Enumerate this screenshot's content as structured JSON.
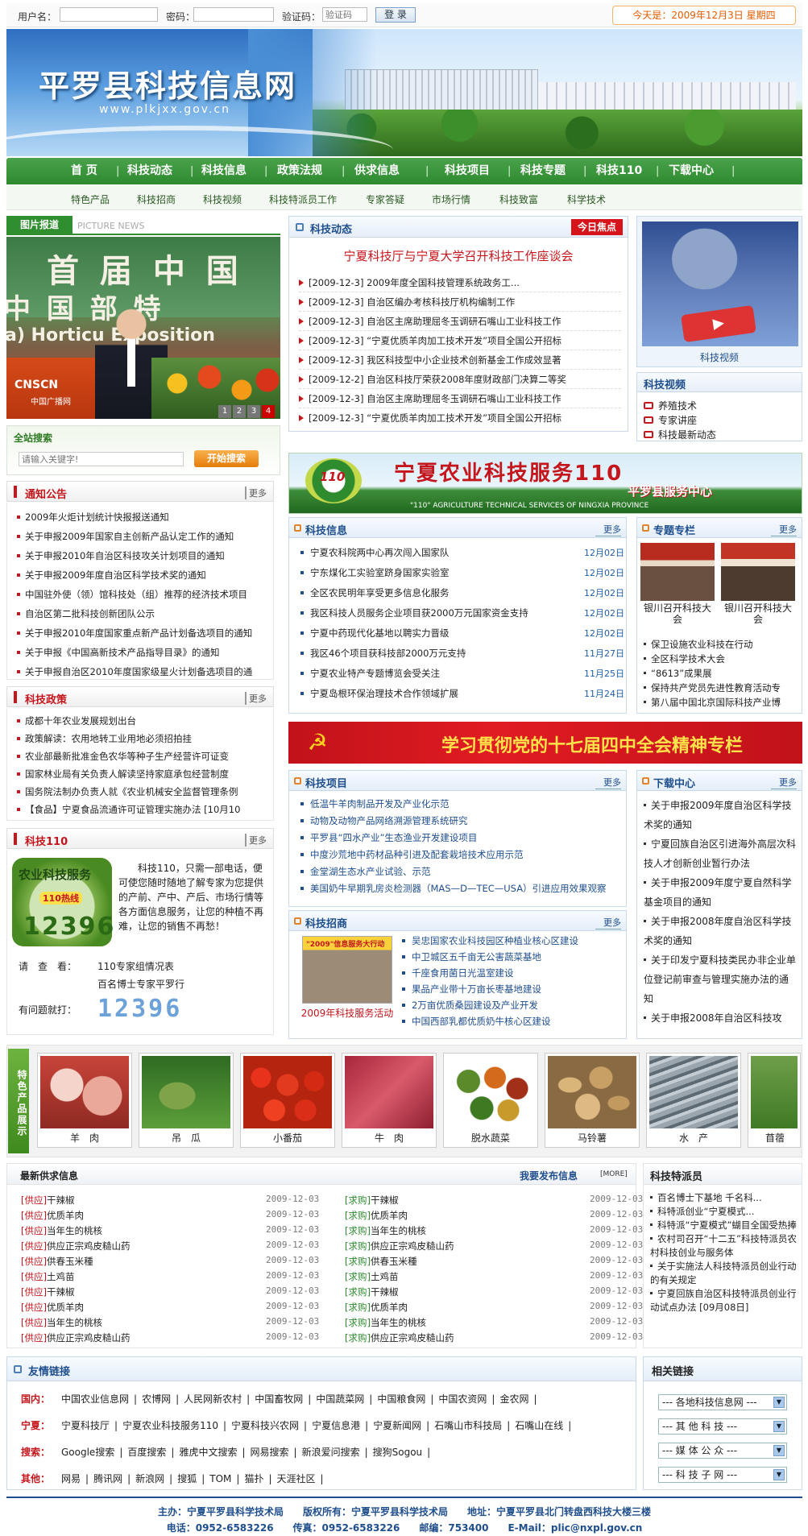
{
  "login": {
    "user_label": "用户名：",
    "pass_label": "密码：",
    "code_label": "验证码：",
    "code_placeholder": "验证码",
    "login_btn": "登 录",
    "date_text": "今天是：2009年12月3日  星期四"
  },
  "banner": {
    "title": "平罗县科技信息网",
    "url": "www.plkjxx.gov.cn"
  },
  "nav": [
    "首  页",
    "科技动态",
    "科技信息",
    "政策法规",
    "供求信息",
    "科技项目",
    "科技专题",
    "科技110",
    "下载中心"
  ],
  "subnav": [
    "特色产品",
    "科技招商",
    "科技视频",
    "科技特派员工作",
    "专家答疑",
    "市场行情",
    "科技致富",
    "科学技术"
  ],
  "photo": {
    "tab": "图片报道",
    "tab_en": "PICTURE NEWS",
    "caption_big": "首 届 中 国",
    "caption_2": "中 国  部 特",
    "caption_3": "a) Horticu   Exposition",
    "logo": "CNSCN",
    "logo_sub": "中国广播网",
    "pages": [
      "1",
      "2",
      "3",
      "4"
    ]
  },
  "search": {
    "title": "全站搜索",
    "placeholder": "请输入关键字!",
    "btn": "开始搜索"
  },
  "notice": {
    "title": "通知公告",
    "more": "更多",
    "items": [
      "2009年火炬计划统计快报报送通知",
      "关于申报2009年国家自主创新产品认定工作的通知",
      "关于申报2010年自治区科技攻关计划项目的通知",
      "关于申报2009年度自治区科学技术奖的通知",
      "中国驻外使（领）馆科技处（组）推荐的经济技术项目",
      "自治区第二批科技创新团队公示",
      "关于申报2010年度国家重点新产品计划备选项目的通知",
      "关于申报《中国高新技术产品指导目录》的通知",
      "关于申报自治区2010年度国家级星火计划备选项目的通"
    ]
  },
  "policy": {
    "title": "科技政策",
    "more": "更多",
    "items": [
      "成都十年农业发展规划出台",
      "政策解读：农用地转工业用地必须招拍挂",
      "农业部最新批准金色农华等种子生产经营许可证变",
      "国家林业局有关负责人解读坚持家庭承包经营制度",
      "国务院法制办负责人就《农业机械安全监督管理条例",
      "【食品】宁夏食品流通许可证管理实施办法 [10月10"
    ]
  },
  "k110": {
    "title": "科技110",
    "more": "更多",
    "logo_top": "农业科技服务",
    "logo_hot": "110热线",
    "logo_num": "12396",
    "text": "科技110，只需一部电话，便可使您随时随地了解专家为您提供的产前、产中、产后、市场行情等各方面信息服务，让您的种植不再难，让您的销售不再愁！",
    "please": "请　查　看：",
    "see1": "110专家组情况表",
    "see2": "百名博士专家平罗行",
    "ask": "有问题就打：",
    "num": "12396"
  },
  "dynamic": {
    "title": "科技动态",
    "focus": "今日焦点",
    "headline": "宁夏科技厅与宁夏大学召开科技工作座谈会",
    "items": [
      "[2009-12-3] 2009年度全国科技管理系统政务工...",
      "[2009-12-3] 自治区编办考核科技厅机构编制工作",
      "[2009-12-3] 自治区主席助理屈冬玉调研石嘴山工业科技工作",
      "[2009-12-3] “宁夏优质羊肉加工技术开发”项目全国公开招标",
      "[2009-12-3] 我区科技型中小企业技术创新基金工作成效显著",
      "[2009-12-2] 自治区科技厅荣获2008年度财政部门决算二等奖",
      "[2009-12-3] 自治区主席助理屈冬玉调研石嘴山工业科技工作",
      "[2009-12-3] “宁夏优质羊肉加工技术开发”项目全国公开招标"
    ]
  },
  "video_card": {
    "caption": "科技视频"
  },
  "video": {
    "title": "科技视频",
    "items": [
      "养殖技术",
      "专家讲座",
      "科技最新动态"
    ]
  },
  "banner110": {
    "title": "宁夏农业科技服务110",
    "sub": "平罗县服务中心",
    "en": "\"110\" AGRICULTURE TECHNICAL SERVICES OF NINGXIA PROVINCE",
    "badge": "110"
  },
  "info": {
    "title": "科技信息",
    "more": "更多",
    "items": [
      {
        "t": "宁夏农科院两中心再次闯入国家队",
        "d": "12月02日"
      },
      {
        "t": "宁东煤化工实验室跻身国家实验室",
        "d": "12月02日"
      },
      {
        "t": "全区农民明年享受更多信息化服务",
        "d": "12月02日"
      },
      {
        "t": "我区科技人员服务企业项目获2000万元国家资金支持",
        "d": "12月02日"
      },
      {
        "t": "宁夏中药现代化基地以聘实力晋级",
        "d": "12月02日"
      },
      {
        "t": "我区46个项目获科技部2000万元支持",
        "d": "11月27日"
      },
      {
        "t": "宁夏农业特产专题博览会受关注",
        "d": "11月25日"
      },
      {
        "t": "宁夏岛根环保治理技术合作领域扩展",
        "d": "11月24日"
      }
    ]
  },
  "topic": {
    "title": "专题专栏",
    "more": "更多",
    "cap1": "银川召开科技大会",
    "cap2": "银川召开科技大会",
    "items": [
      "保卫设施农业科技在行动",
      "全区科学技术大会",
      "“8613”成果展",
      "保持共产党员先进性教育活动专",
      "第八届中国北京国际科技产业博"
    ]
  },
  "party": {
    "text": "学习贯彻党的十七届四中全会精神专栏"
  },
  "project": {
    "title": "科技项目",
    "more": "更多",
    "items": [
      "低温牛羊肉制品开发及产业化示范",
      "动物及动物产品网络溯源管理系统研究",
      "平罗县“四水产业”生态渔业开发建设项目",
      "中度沙荒地中药材品种引进及配套栽培技术应用示范",
      "金堂湖生态水产业试验、示范",
      "美国奶牛早期乳房炎检测器（MAS—D—TEC—USA）引进应用效果观察"
    ]
  },
  "invest": {
    "title": "科技招商",
    "more": "更多",
    "banner": "\"2009\"信息服务大行动",
    "caption": "2009年科技服务活动",
    "items": [
      "吴忠国家农业科技园区种植业核心区建设",
      "中卫城区五千亩无公害蔬菜基地",
      "千座食用菌日光温室建设",
      "果品产业带十万亩长枣基地建设",
      "2万亩优质桑园建设及产业开发",
      "中国西部乳都优质奶牛核心区建设"
    ]
  },
  "download": {
    "title": "下载中心",
    "more": "更多",
    "items": [
      "关于申报2009年度自治区科学技术奖的通知",
      "宁夏回族自治区引进海外高层次科技人才创新创业暂行办法",
      "关于申报2009年度宁夏自然科学基金项目的通知",
      "关于申报2008年度自治区科学技术奖的通知",
      "关于印发宁夏科技类民办非企业单位登记前审查与管理实施办法的通知",
      "关于申报2008年自治区科技攻"
    ]
  },
  "products": {
    "side": "特色产品展示",
    "items": [
      "羊　肉",
      "吊　瓜",
      "小番茄",
      "牛　肉",
      "脱水蔬菜",
      "马铃薯",
      "水　产",
      "苜蓿"
    ]
  },
  "supply": {
    "title": "最新供求信息",
    "publish": "我要发布信息",
    "more": "[MORE]",
    "left": [
      {
        "tag": "[供应]",
        "t": "干辣椒",
        "d": "2009-12-03"
      },
      {
        "tag": "[供应]",
        "t": "优质羊肉",
        "d": "2009-12-03"
      },
      {
        "tag": "[供应]",
        "t": "当年生的桃核",
        "d": "2009-12-03"
      },
      {
        "tag": "[供应]",
        "t": "供应正宗鸡皮糙山药",
        "d": "2009-12-03"
      },
      {
        "tag": "[供应]",
        "t": "供春玉米種",
        "d": "2009-12-03"
      },
      {
        "tag": "[供应]",
        "t": "土鸡苗",
        "d": "2009-12-03"
      },
      {
        "tag": "[供应]",
        "t": "干辣椒",
        "d": "2009-12-03"
      },
      {
        "tag": "[供应]",
        "t": "优质羊肉",
        "d": "2009-12-03"
      },
      {
        "tag": "[供应]",
        "t": "当年生的桃核",
        "d": "2009-12-03"
      },
      {
        "tag": "[供应]",
        "t": "供应正宗鸡皮糙山药",
        "d": "2009-12-03"
      }
    ],
    "right": [
      {
        "tag": "[求购]",
        "t": "干辣椒",
        "d": "2009-12-03"
      },
      {
        "tag": "[求购]",
        "t": "优质羊肉",
        "d": "2009-12-03"
      },
      {
        "tag": "[求购]",
        "t": "当年生的桃核",
        "d": "2009-12-03"
      },
      {
        "tag": "[求购]",
        "t": "供应正宗鸡皮糙山药",
        "d": "2009-12-03"
      },
      {
        "tag": "[求购]",
        "t": "供春玉米種",
        "d": "2009-12-03"
      },
      {
        "tag": "[求购]",
        "t": "土鸡苗",
        "d": "2009-12-03"
      },
      {
        "tag": "[求购]",
        "t": "干辣椒",
        "d": "2009-12-03"
      },
      {
        "tag": "[求购]",
        "t": "优质羊肉",
        "d": "2009-12-03"
      },
      {
        "tag": "[求购]",
        "t": "当年生的桃核",
        "d": "2009-12-03"
      },
      {
        "tag": "[求购]",
        "t": "供应正宗鸡皮糙山药",
        "d": "2009-12-03"
      }
    ]
  },
  "envoy": {
    "title": "科技特派员",
    "items": [
      "百名博士下基地  千名科...",
      "科特派创业“宁夏模式...",
      "科特派“宁夏模式”蝴目全国受热捧",
      "农村司召开“十二五”科技特派员农村科技创业与服务体",
      "关于实施法人科技特派员创业行动的有关规定",
      "宁夏回族自治区科技特派员创业行动试点办法  [09月08日]"
    ]
  },
  "links": {
    "title": "友情链接",
    "rows": [
      {
        "k": "国内：",
        "v": [
          "中国农业信息网",
          "农博网",
          "人民网新农村",
          "中国畜牧网",
          "中国蔬菜网",
          "中国粮食网",
          "中国农资网",
          "金农网"
        ]
      },
      {
        "k": "宁夏：",
        "v": [
          "宁夏科技厅",
          "宁夏农业科技服务110",
          "宁夏科技兴农网",
          "宁夏信息港",
          "宁夏新闻网",
          "石嘴山市科技局",
          "石嘴山在线"
        ]
      },
      {
        "k": "搜索：",
        "v": [
          "Google搜索",
          "百度搜索",
          "雅虎中文搜索",
          "网易搜索",
          "新浪爱问搜索",
          "搜狗Sogou"
        ]
      },
      {
        "k": "其他：",
        "v": [
          "网易",
          "腾讯网",
          "新浪网",
          "搜狐",
          "TOM",
          "猫扑",
          "天涯社区"
        ]
      }
    ]
  },
  "related": {
    "title": "相关链接",
    "selects": [
      "--- 各地科技信息网 ---",
      "--- 其 他 科 技 ---",
      "--- 媒 体 公 众 ---",
      "--- 科 技 子 网 ---"
    ]
  },
  "footer": {
    "line1": "主办：宁夏平罗县科学技术局　　版权所有：宁夏平罗县科学技术局　　地址：宁夏平罗县北门转盘西科技大楼三楼",
    "line2": "电话：0952-6583226　　传真：0952-6583226　　邮编：753400　　E-Mail：plic@nxpl.gov.cn"
  },
  "colors": {
    "nav_green": "#2d8a2f",
    "brand_blue": "#1f4e8c",
    "alert_red": "#c4161c",
    "orange": "#e35b00"
  }
}
